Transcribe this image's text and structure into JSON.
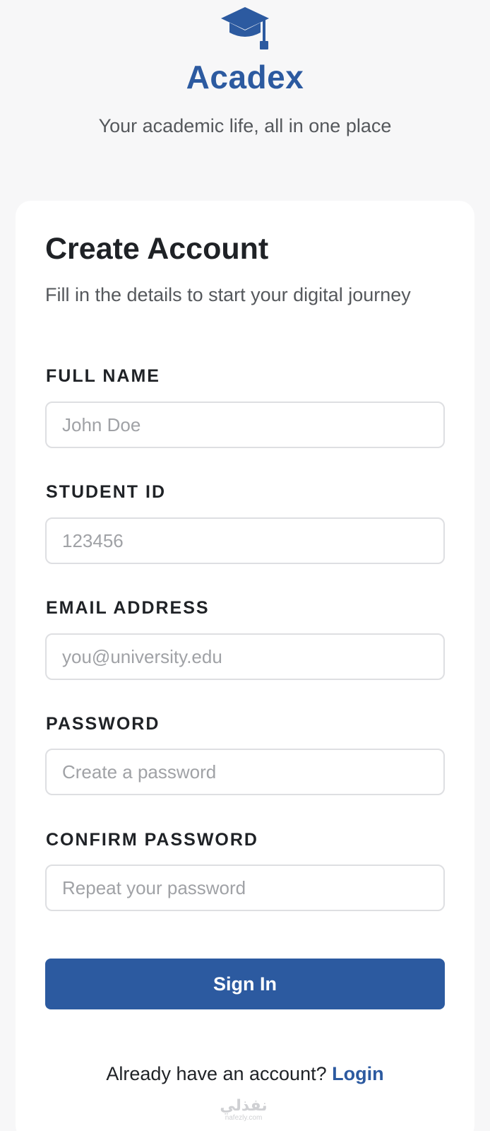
{
  "brand": {
    "icon": "graduation-cap-icon",
    "name": "Acadex",
    "tagline": "Your academic life, all in one place",
    "color": "#2c5aa0"
  },
  "form": {
    "title": "Create Account",
    "subtitle": "Fill in the details to start your digital journey",
    "fields": [
      {
        "label": "FULL NAME",
        "placeholder": "John Doe",
        "value": ""
      },
      {
        "label": "STUDENT ID",
        "placeholder": "123456",
        "value": ""
      },
      {
        "label": "EMAIL ADDRESS",
        "placeholder": "you@university.edu",
        "value": ""
      },
      {
        "label": "PASSWORD",
        "placeholder": "Create a password",
        "value": ""
      },
      {
        "label": "CONFIRM PASSWORD",
        "placeholder": "Repeat your password",
        "value": ""
      }
    ],
    "submit_label": "Sign In"
  },
  "footer": {
    "prompt": "Already have an account?",
    "link_label": "Login"
  },
  "watermark": {
    "arabic": "نفذلي",
    "latin": "nafezly.com"
  }
}
